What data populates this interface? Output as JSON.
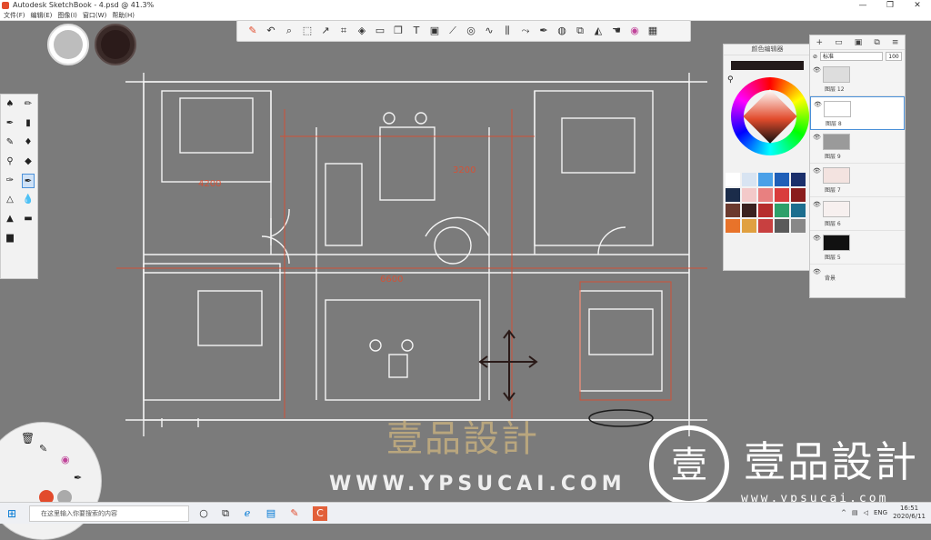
{
  "window": {
    "title": "Autodesk SketchBook - 4.psd @ 41.3%",
    "controls": [
      "—",
      "❐",
      "✕"
    ]
  },
  "menu": [
    "文件(F)",
    "编辑(E)",
    "图像(I)",
    "窗口(W)",
    "帮助(H)"
  ],
  "toolbar": {
    "icons": [
      "brush-icon",
      "zoom-icon",
      "select-icon",
      "transform-icon",
      "crop-icon",
      "distort-icon",
      "rect-icon",
      "text-icon",
      "ruler-icon",
      "ellipse-icon",
      "curve-icon",
      "symmetry-icon",
      "gradient-icon",
      "fill-icon",
      "color-wheel-icon",
      "grid-icon"
    ]
  },
  "colors": {
    "primary": "#bdbdbd",
    "secondary": "#2b1b1a",
    "accent": "#e24b2c"
  },
  "color_panel": {
    "header": "颜色编辑器",
    "palette": [
      "#ffffff",
      "#d8e4f2",
      "#4aa0e8",
      "#1f5fb8",
      "#1b2f6b",
      "#1b2c4a",
      "#f3c9c9",
      "#e88080",
      "#d93c3c",
      "#8a1c1c",
      "#6b3a2e",
      "#3a2220",
      "#b62d2d",
      "#2ea06a",
      "#1d6e8e",
      "#e8732a",
      "#e0a040",
      "#c84040",
      "#5a5a5a",
      "#888888"
    ]
  },
  "layers": {
    "blend_mode": "标准",
    "opacity": "100",
    "items": [
      {
        "name": "图层 12"
      },
      {
        "name": "图层 8"
      },
      {
        "name": "图层 9"
      },
      {
        "name": "图层 7"
      },
      {
        "name": "图层 6"
      },
      {
        "name": "图层 5"
      },
      {
        "name": "背景"
      }
    ]
  },
  "watermark": {
    "cn": "壹品設計",
    "url": "WWW.YPSUCAI.COM",
    "brand_cn": "壹品設計",
    "brand_url": "www.ypsucai.com"
  },
  "taskbar": {
    "search_placeholder": "在这里输入你要搜索的内容",
    "lang": "ENG",
    "time": "16:51",
    "date": "2020/6/11"
  }
}
